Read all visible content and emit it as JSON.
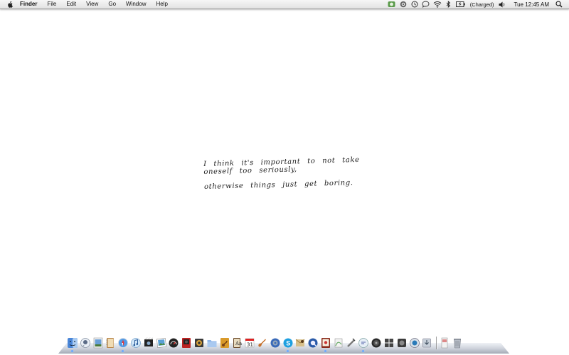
{
  "menubar": {
    "apple_icon": "apple-icon",
    "app_name": "Finder",
    "menus": [
      "File",
      "Edit",
      "View",
      "Go",
      "Window",
      "Help"
    ],
    "status": {
      "battery_text": "(Charged)",
      "clock": "Tue 12:45 AM"
    }
  },
  "desktop": {
    "note_line1": "I think it's important to not take oneself too seriously,",
    "note_line2": "otherwise things just get boring."
  },
  "dock": {
    "icons": [
      "finder-icon",
      "ichat-icon",
      "preview-icon",
      "address-book-icon",
      "safari-icon",
      "itunes-icon",
      "imovie-icon",
      "iphoto-icon",
      "dashboard-icon",
      "photo-booth-icon",
      "aperture-icon",
      "folder-icon",
      "garageband-icon",
      "dictionary-icon",
      "ical-icon",
      "garageband-guitar-icon",
      "system-preferences-icon",
      "skype-icon",
      "mail-icon",
      "quicktime-icon",
      "textedit-icon",
      "script-icon",
      "spaces-icon",
      "time-machine-icon",
      "coda-icon",
      "network-icon",
      "instruments-icon",
      "documents-stack-icon",
      "trash-icon"
    ]
  },
  "colors": {
    "menubar_bg": "#ececec",
    "desktop_bg": "#ffffff",
    "dock_shelf": "#c9ced8"
  }
}
